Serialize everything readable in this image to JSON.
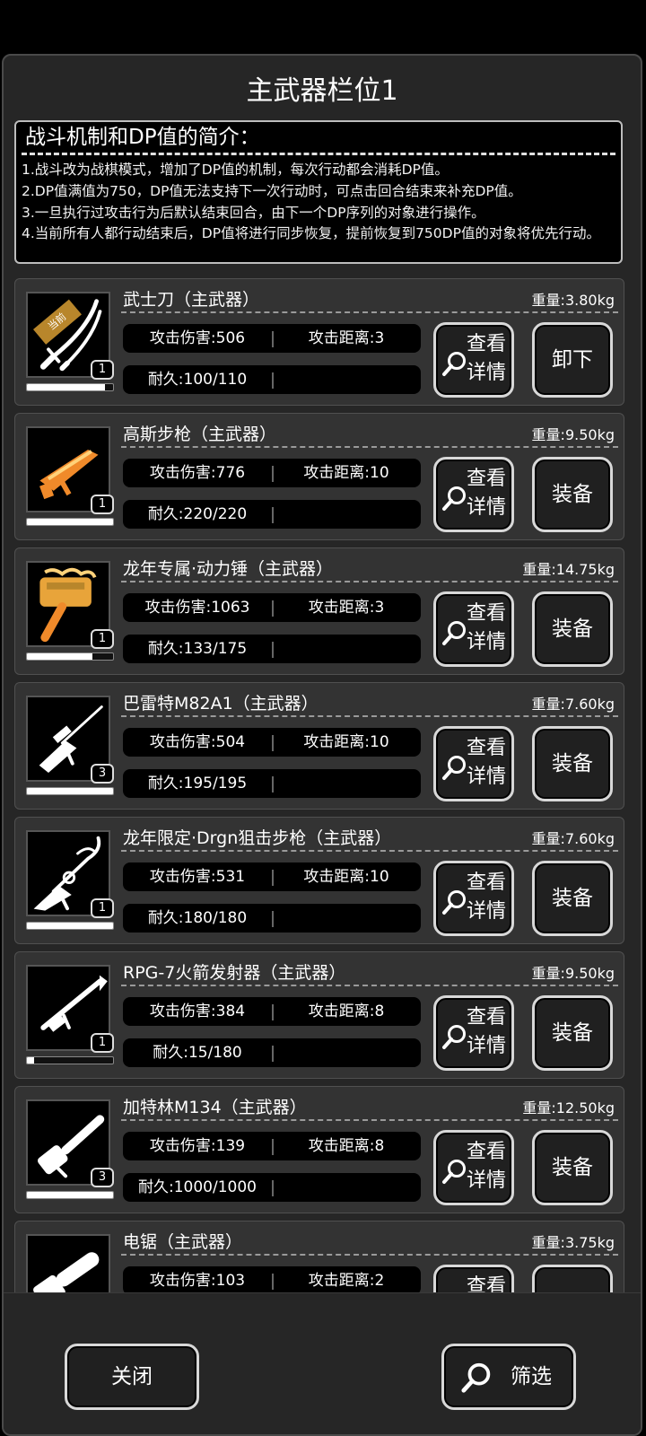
{
  "window": {
    "title": "主武器栏位1"
  },
  "info": {
    "heading": "战斗机制和DP值的简介：",
    "lines": [
      "1.战斗改为战棋模式，增加了DP值的机制，每次行动都会消耗DP值。",
      "2.DP值满值为750，DP值无法支持下一次行动时，可点击回合结束来补充DP值。",
      "3.一旦执行过攻击行为后默认结束回合，由下一个DP序列的对象进行操作。",
      "4.当前所有人都行动结束后，DP值将进行同步恢复，提前恢复到750DP值的对象将优先行动。"
    ]
  },
  "labels": {
    "detail_line1": "查看",
    "detail_line2": "详情",
    "current_badge": "当前"
  },
  "weapons": [
    {
      "name": "武士刀（主武器）",
      "weight": "重量:3.80kg",
      "attack": "攻击伤害:506",
      "range": "攻击距离:3",
      "durability": "耐久:100/110",
      "count": "1",
      "durability_ratio": 0.91,
      "action": "卸下",
      "current": true,
      "icon": "katana-icon"
    },
    {
      "name": "高斯步枪（主武器）",
      "weight": "重量:9.50kg",
      "attack": "攻击伤害:776",
      "range": "攻击距离:10",
      "durability": "耐久:220/220",
      "count": "1",
      "durability_ratio": 1.0,
      "action": "装备",
      "current": false,
      "icon": "gauss-rifle-icon"
    },
    {
      "name": "龙年专属·动力锤（主武器）",
      "weight": "重量:14.75kg",
      "attack": "攻击伤害:1063",
      "range": "攻击距离:3",
      "durability": "耐久:133/175",
      "count": "1",
      "durability_ratio": 0.76,
      "action": "装备",
      "current": false,
      "icon": "power-hammer-icon"
    },
    {
      "name": "巴雷特M82A1（主武器）",
      "weight": "重量:7.60kg",
      "attack": "攻击伤害:504",
      "range": "攻击距离:10",
      "durability": "耐久:195/195",
      "count": "3",
      "durability_ratio": 1.0,
      "action": "装备",
      "current": false,
      "icon": "sniper-rifle-icon"
    },
    {
      "name": "龙年限定·Drgn狙击步枪（主武器）",
      "weight": "重量:7.60kg",
      "attack": "攻击伤害:531",
      "range": "攻击距离:10",
      "durability": "耐久:180/180",
      "count": "1",
      "durability_ratio": 1.0,
      "action": "装备",
      "current": false,
      "icon": "dragon-sniper-icon"
    },
    {
      "name": "RPG-7火箭发射器（主武器）",
      "weight": "重量:9.50kg",
      "attack": "攻击伤害:384",
      "range": "攻击距离:8",
      "durability": "耐久:15/180",
      "count": "1",
      "durability_ratio": 0.08,
      "action": "装备",
      "current": false,
      "icon": "rocket-launcher-icon"
    },
    {
      "name": "加特林M134（主武器）",
      "weight": "重量:12.50kg",
      "attack": "攻击伤害:139",
      "range": "攻击距离:8",
      "durability": "耐久:1000/1000",
      "count": "3",
      "durability_ratio": 1.0,
      "action": "装备",
      "current": false,
      "icon": "minigun-icon"
    },
    {
      "name": "电锯（主武器）",
      "weight": "重量:3.75kg",
      "attack": "攻击伤害:103",
      "range": "攻击距离:2",
      "durability": "",
      "count": "",
      "durability_ratio": null,
      "action": "",
      "current": false,
      "icon": "chainsaw-icon"
    }
  ],
  "footer": {
    "close_label": "关闭",
    "filter_label": "筛选"
  },
  "colors": {
    "panel_bg": "#262626",
    "card_bg": "#333333",
    "border_light": "#d8d8d8",
    "gold": "#e8a43a",
    "orange": "#f08a2a"
  }
}
